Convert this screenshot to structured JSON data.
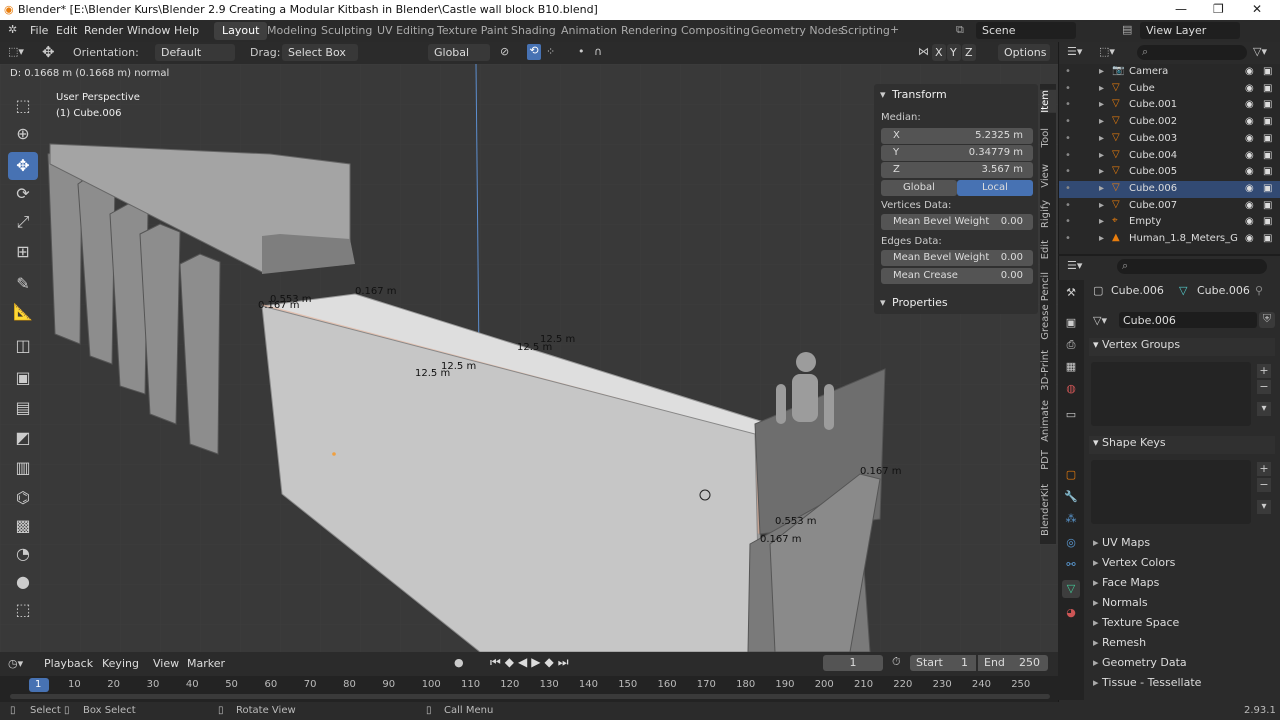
{
  "window": {
    "title": "Blender* [E:\\Blender Kurs\\Blender 2.9 Creating a Modular Kitbash in Blender\\Castle wall block B10.blend]",
    "controls": [
      "—",
      "❐",
      "✕"
    ]
  },
  "menu": [
    "File",
    "Edit",
    "Render",
    "Window",
    "Help"
  ],
  "workspaces": [
    "Layout",
    "Modeling",
    "Sculpting",
    "UV Editing",
    "Texture Paint",
    "Shading",
    "Animation",
    "Rendering",
    "Compositing",
    "Geometry Nodes",
    "Scripting"
  ],
  "scene": "Scene",
  "view_layer": "View Layer",
  "vp_header": {
    "orientation_label": "Orientation:",
    "orientation": "Default",
    "drag_label": "Drag:",
    "drag": "Select Box",
    "transform_orient": "Global",
    "options": "Options",
    "axes": [
      "X",
      "Y",
      "Z"
    ]
  },
  "vp_overlay": {
    "status": "D: 0.1668 m (0.1668 m) normal",
    "perspective": "User Perspective",
    "object": "(1) Cube.006"
  },
  "npanel": {
    "title": "Transform",
    "median": "Median:",
    "x_label": "X",
    "x": "5.2325 m",
    "y_label": "Y",
    "y": "0.34779 m",
    "z_label": "Z",
    "z": "3.567 m",
    "global": "Global",
    "local": "Local",
    "vertices_data": "Vertices Data:",
    "mean_bevel_label": "Mean Bevel Weight",
    "mean_bevel_v": "0.00",
    "edges_data": "Edges Data:",
    "mean_bevel_e": "0.00",
    "mean_crease_label": "Mean Crease",
    "mean_crease": "0.00",
    "properties": "Properties"
  },
  "side_tabs": [
    "Item",
    "Tool",
    "View",
    "Rigify",
    "Edit",
    "Grease Pencil",
    "3D-Print",
    "Animate",
    "PDT",
    "BlenderKit"
  ],
  "measurements": [
    "12.5 m",
    "12.5 m",
    "12.5 m",
    "12.5 m",
    "0.167 m",
    "0.553 m",
    "0.167 m",
    "0.167 m",
    "0.553 m",
    "0.167 m"
  ],
  "outliner": [
    {
      "name": "Camera",
      "sel": false
    },
    {
      "name": "Cube",
      "sel": false
    },
    {
      "name": "Cube.001",
      "sel": false
    },
    {
      "name": "Cube.002",
      "sel": false
    },
    {
      "name": "Cube.003",
      "sel": false
    },
    {
      "name": "Cube.004",
      "sel": false
    },
    {
      "name": "Cube.005",
      "sel": false
    },
    {
      "name": "Cube.006",
      "sel": true
    },
    {
      "name": "Cube.007",
      "sel": false
    },
    {
      "name": "Empty",
      "sel": false
    },
    {
      "name": "Human_1.8_Meters_G",
      "sel": false
    }
  ],
  "props": {
    "object": "Cube.006",
    "mesh": "Cube.006",
    "data_name": "Cube.006",
    "sections": [
      "Vertex Groups",
      "Shape Keys",
      "UV Maps",
      "Vertex Colors",
      "Face Maps",
      "Normals",
      "Texture Space",
      "Remesh",
      "Geometry Data",
      "Tissue - Tessellate"
    ]
  },
  "timeline": {
    "playback": "Playback",
    "keying": "Keying",
    "view": "View",
    "marker": "Marker",
    "frame": "1",
    "start_label": "Start",
    "start": "1",
    "end_label": "End",
    "end": "250",
    "ticks": [
      "1",
      "10",
      "20",
      "30",
      "40",
      "50",
      "60",
      "70",
      "80",
      "90",
      "100",
      "110",
      "120",
      "130",
      "140",
      "150",
      "160",
      "170",
      "180",
      "190",
      "200",
      "210",
      "220",
      "230",
      "240",
      "250"
    ]
  },
  "status": {
    "select": "Select",
    "box_select": "Box Select",
    "rotate": "Rotate View",
    "call_menu": "Call Menu",
    "version": "2.93.1"
  }
}
